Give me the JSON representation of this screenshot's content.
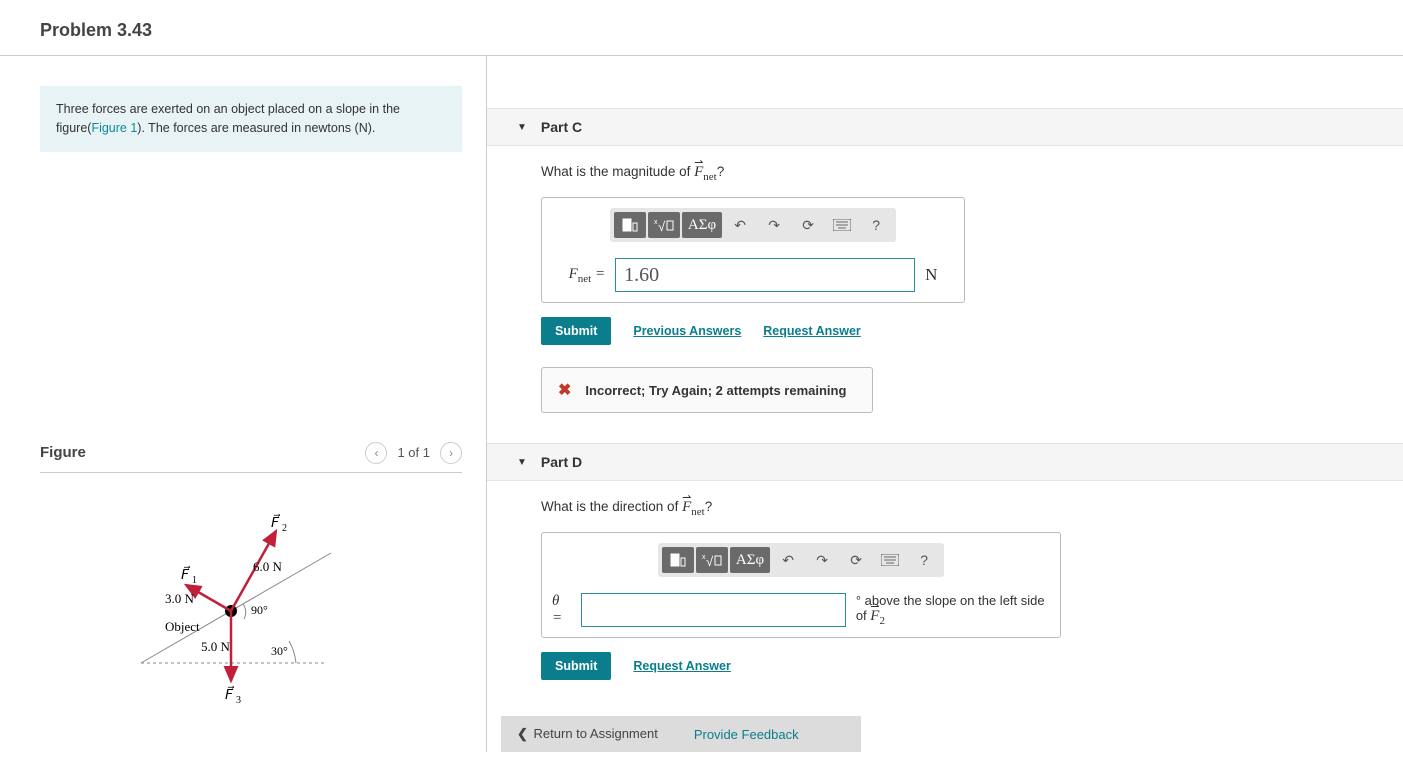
{
  "page_title": "Problem 3.43",
  "prompt": {
    "text_before": "Three forces are exerted on an object placed on a slope in the figure(",
    "link_text": "Figure 1",
    "text_after": "). The forces are measured in newtons (N)."
  },
  "figure": {
    "heading": "Figure",
    "counter": "1 of 1",
    "labels": {
      "F1": "F⃗₁",
      "F2": "F⃗₂",
      "F3": "F⃗₃",
      "F1_mag": "3.0 N",
      "F2_mag": "6.0 N",
      "F3_mag": "5.0 N",
      "angle1": "90°",
      "angle2": "30°",
      "object": "Object"
    }
  },
  "partC": {
    "title": "Part C",
    "question_before": "What is the magnitude of ",
    "question_symbol": "F⃗",
    "question_sub": "net",
    "question_after": "?",
    "lhs": "F",
    "lhs_sub": "net",
    "eq": " = ",
    "input_value": "1.60",
    "unit": "N",
    "submit_label": "Submit",
    "prev_answers_label": "Previous Answers",
    "request_answer_label": "Request Answer",
    "feedback": "Incorrect; Try Again; 2 attempts remaining"
  },
  "partD": {
    "title": "Part D",
    "question_before": "What is the direction of ",
    "question_symbol": "F⃗",
    "question_sub": "net",
    "question_after": "?",
    "lhs": "θ",
    "eq": " = ",
    "input_value": "",
    "unit_before": "° ",
    "unit_text": "above the slope on the left side of ",
    "unit_symbol": "F⃗",
    "unit_sub": "2",
    "submit_label": "Submit",
    "request_answer_label": "Request Answer"
  },
  "toolbar": {
    "template": "template-icon",
    "root": "root-icon",
    "greek": "ΑΣφ",
    "undo": "↶",
    "redo": "↷",
    "reset": "⟳",
    "keyboard": "⌨",
    "help": "?"
  },
  "bottom": {
    "return": "Return to Assignment",
    "feedback": "Provide Feedback"
  }
}
